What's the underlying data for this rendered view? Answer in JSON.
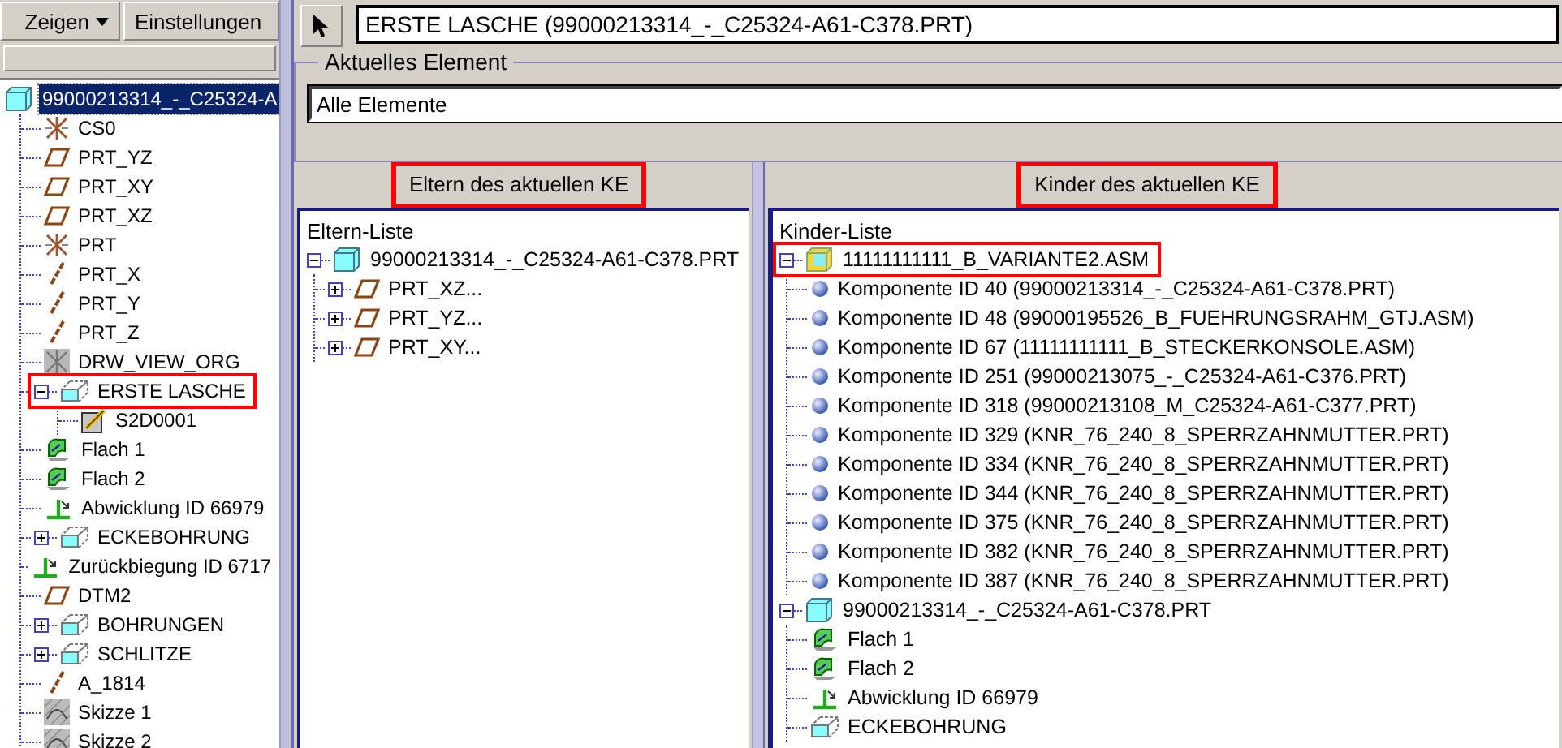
{
  "toolbar": {
    "buttons": [
      {
        "label": "Zeigen",
        "kind": "menu"
      },
      {
        "label": "Einstellungen",
        "kind": "plain"
      }
    ]
  },
  "model_tree": {
    "items": [
      {
        "label": "99000213314_-_C25324-A",
        "kind": "part",
        "selected": true,
        "highlighted": false,
        "children": [
          {
            "label": "CS0",
            "kind": "csys",
            "selected": false,
            "highlighted": false
          },
          {
            "label": "PRT_YZ",
            "kind": "plane",
            "selected": false,
            "highlighted": false
          },
          {
            "label": "PRT_XY",
            "kind": "plane",
            "selected": false,
            "highlighted": false
          },
          {
            "label": "PRT_XZ",
            "kind": "plane",
            "selected": false,
            "highlighted": false
          },
          {
            "label": "PRT",
            "kind": "csys",
            "selected": false,
            "highlighted": false
          },
          {
            "label": "PRT_X",
            "kind": "axis",
            "selected": false,
            "highlighted": false
          },
          {
            "label": "PRT_Y",
            "kind": "axis",
            "selected": false,
            "highlighted": false
          },
          {
            "label": "PRT_Z",
            "kind": "axis",
            "selected": false,
            "highlighted": false
          },
          {
            "label": "DRW_VIEW_ORG",
            "kind": "view",
            "selected": false,
            "highlighted": false
          },
          {
            "label": "ERSTE LASCHE",
            "kind": "feature",
            "selected": false,
            "highlighted": true,
            "expanded": true,
            "children": [
              {
                "label": "S2D0001",
                "kind": "sketchpen",
                "selected": false,
                "highlighted": false
              }
            ]
          },
          {
            "label": "Flach 1",
            "kind": "surface",
            "selected": false,
            "highlighted": false
          },
          {
            "label": "Flach 2",
            "kind": "surface",
            "selected": false,
            "highlighted": false
          },
          {
            "label": "Abwicklung ID 66979",
            "kind": "unbend",
            "selected": false,
            "highlighted": false
          },
          {
            "label": "ECKEBOHRUNG",
            "kind": "feature",
            "selected": false,
            "highlighted": false,
            "expanded": false
          },
          {
            "label": "Zurückbiegung ID 6717",
            "kind": "bend",
            "selected": false,
            "highlighted": false
          },
          {
            "label": "DTM2",
            "kind": "plane",
            "selected": false,
            "highlighted": false
          },
          {
            "label": "BOHRUNGEN",
            "kind": "feature",
            "selected": false,
            "highlighted": false,
            "expanded": false
          },
          {
            "label": "SCHLITZE",
            "kind": "feature",
            "selected": false,
            "highlighted": false,
            "expanded": false
          },
          {
            "label": "A_1814",
            "kind": "axis",
            "selected": false,
            "highlighted": false
          },
          {
            "label": "Skizze 1",
            "kind": "sketch",
            "selected": false,
            "highlighted": false
          },
          {
            "label": "Skizze 2",
            "kind": "sketch",
            "selected": false,
            "highlighted": false
          }
        ]
      }
    ]
  },
  "selection": {
    "value": "ERSTE LASCHE (99000213314_-_C25324-A61-C378.PRT)"
  },
  "current_element": {
    "title": "Aktuelles Element",
    "value": "Alle Elemente"
  },
  "parents": {
    "header": "Eltern des aktuellen KE",
    "highlighted": true,
    "list_title": "Eltern-Liste",
    "items": [
      {
        "label": "99000213314_-_C25324-A61-C378.PRT",
        "kind": "part",
        "highlighted": false,
        "expanded": true,
        "children": [
          {
            "label": "PRT_XZ...",
            "kind": "plane",
            "highlighted": false,
            "expanded": false
          },
          {
            "label": "PRT_YZ...",
            "kind": "plane",
            "highlighted": false,
            "expanded": false
          },
          {
            "label": "PRT_XY...",
            "kind": "plane",
            "highlighted": false,
            "expanded": false
          }
        ]
      }
    ]
  },
  "children": {
    "header": "Kinder des aktuellen KE",
    "highlighted": true,
    "list_title": "Kinder-Liste",
    "items": [
      {
        "label": "11111111111_B_VARIANTE2.ASM",
        "kind": "assembly",
        "highlighted": true,
        "expanded": true,
        "children": [
          {
            "label": "Komponente ID 40 (99000213314_-_C25324-A61-C378.PRT)",
            "kind": "component",
            "highlighted": false
          },
          {
            "label": "Komponente ID 48 (99000195526_B_FUEHRUNGSRAHM_GTJ.ASM)",
            "kind": "component",
            "highlighted": false
          },
          {
            "label": "Komponente ID 67 (11111111111_B_STECKERKONSOLE.ASM)",
            "kind": "component",
            "highlighted": false
          },
          {
            "label": "Komponente ID 251 (99000213075_-_C25324-A61-C376.PRT)",
            "kind": "component",
            "highlighted": false
          },
          {
            "label": "Komponente ID 318 (99000213108_M_C25324-A61-C377.PRT)",
            "kind": "component",
            "highlighted": false
          },
          {
            "label": "Komponente ID 329 (KNR_76_240_8_SPERRZAHNMUTTER.PRT)",
            "kind": "component",
            "highlighted": false
          },
          {
            "label": "Komponente ID 334 (KNR_76_240_8_SPERRZAHNMUTTER.PRT)",
            "kind": "component",
            "highlighted": false
          },
          {
            "label": "Komponente ID 344 (KNR_76_240_8_SPERRZAHNMUTTER.PRT)",
            "kind": "component",
            "highlighted": false
          },
          {
            "label": "Komponente ID 375 (KNR_76_240_8_SPERRZAHNMUTTER.PRT)",
            "kind": "component",
            "highlighted": false
          },
          {
            "label": "Komponente ID 382 (KNR_76_240_8_SPERRZAHNMUTTER.PRT)",
            "kind": "component",
            "highlighted": false
          },
          {
            "label": "Komponente ID 387 (KNR_76_240_8_SPERRZAHNMUTTER.PRT)",
            "kind": "component",
            "highlighted": false
          }
        ]
      },
      {
        "label": "99000213314_-_C25324-A61-C378.PRT",
        "kind": "part",
        "highlighted": false,
        "expanded": true,
        "children": [
          {
            "label": "Flach 1",
            "kind": "surface",
            "highlighted": false
          },
          {
            "label": "Flach 2",
            "kind": "surface",
            "highlighted": false
          },
          {
            "label": "Abwicklung ID 66979",
            "kind": "unbend",
            "highlighted": false
          },
          {
            "label": "ECKEBOHRUNG",
            "kind": "feature",
            "highlighted": false
          }
        ]
      }
    ]
  }
}
